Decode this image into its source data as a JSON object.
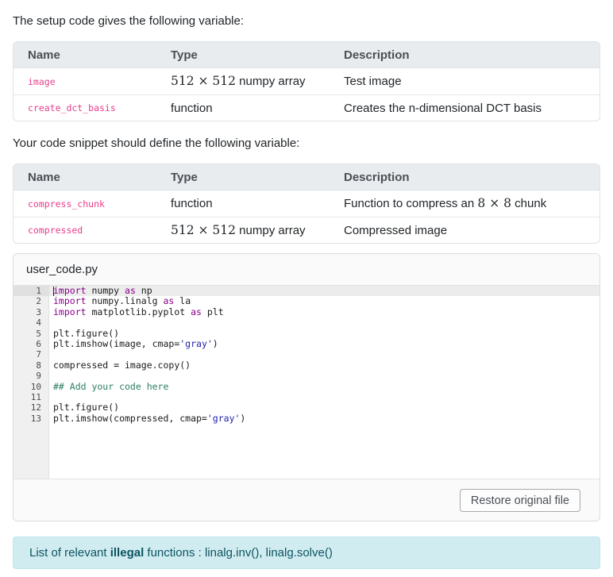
{
  "colors": {
    "accent_code_pink": "#e83e8c",
    "table_header_bg": "#e9ecef",
    "table_border": "#dee2e6",
    "editor_keyword": "#8b008b",
    "editor_string": "#1f1fa8",
    "editor_comment": "#2a7f62",
    "alert_bg": "#d1ecf1",
    "alert_text": "#0c5460"
  },
  "sections": [
    {
      "intro": "The setup code gives the following variable:",
      "columns": [
        "Name",
        "Type",
        "Description"
      ],
      "rows": [
        {
          "name": "image",
          "type": [
            {
              "t": "math",
              "v": "512 × 512"
            },
            {
              "t": "text",
              "v": " numpy array"
            }
          ],
          "description": [
            {
              "t": "text",
              "v": "Test image"
            }
          ]
        },
        {
          "name": "create_dct_basis",
          "type": [
            {
              "t": "text",
              "v": "function"
            }
          ],
          "description": [
            {
              "t": "text",
              "v": "Creates the n-dimensional DCT basis"
            }
          ]
        }
      ]
    },
    {
      "intro": "Your code snippet should define the following variable:",
      "columns": [
        "Name",
        "Type",
        "Description"
      ],
      "rows": [
        {
          "name": "compress_chunk",
          "type": [
            {
              "t": "text",
              "v": "function"
            }
          ],
          "description": [
            {
              "t": "text",
              "v": "Function to compress an "
            },
            {
              "t": "math",
              "v": "8 × 8"
            },
            {
              "t": "text",
              "v": " chunk"
            }
          ]
        },
        {
          "name": "compressed",
          "type": [
            {
              "t": "math",
              "v": "512 × 512"
            },
            {
              "t": "text",
              "v": " numpy array"
            }
          ],
          "description": [
            {
              "t": "text",
              "v": "Compressed image"
            }
          ]
        }
      ]
    }
  ],
  "editor": {
    "filename": "user_code.py",
    "active_line": 1,
    "lines": [
      {
        "num": 1,
        "segments": [
          {
            "t": "kw",
            "v": "import"
          },
          {
            "t": "txt",
            "v": " numpy "
          },
          {
            "t": "kw",
            "v": "as"
          },
          {
            "t": "txt",
            "v": " np"
          }
        ]
      },
      {
        "num": 2,
        "segments": [
          {
            "t": "kw",
            "v": "import"
          },
          {
            "t": "txt",
            "v": " numpy.linalg "
          },
          {
            "t": "kw",
            "v": "as"
          },
          {
            "t": "txt",
            "v": " la"
          }
        ]
      },
      {
        "num": 3,
        "segments": [
          {
            "t": "kw",
            "v": "import"
          },
          {
            "t": "txt",
            "v": " matplotlib.pyplot "
          },
          {
            "t": "kw",
            "v": "as"
          },
          {
            "t": "txt",
            "v": " plt"
          }
        ]
      },
      {
        "num": 4,
        "segments": []
      },
      {
        "num": 5,
        "segments": [
          {
            "t": "txt",
            "v": "plt.figure()"
          }
        ]
      },
      {
        "num": 6,
        "segments": [
          {
            "t": "txt",
            "v": "plt.imshow(image, cmap="
          },
          {
            "t": "str",
            "v": "'gray'"
          },
          {
            "t": "txt",
            "v": ")"
          }
        ]
      },
      {
        "num": 7,
        "segments": []
      },
      {
        "num": 8,
        "segments": [
          {
            "t": "txt",
            "v": "compressed = image.copy()"
          }
        ]
      },
      {
        "num": 9,
        "segments": []
      },
      {
        "num": 10,
        "segments": [
          {
            "t": "com",
            "v": "## Add your code here"
          }
        ]
      },
      {
        "num": 11,
        "segments": []
      },
      {
        "num": 12,
        "segments": [
          {
            "t": "txt",
            "v": "plt.figure()"
          }
        ]
      },
      {
        "num": 13,
        "segments": [
          {
            "t": "txt",
            "v": "plt.imshow(compressed, cmap="
          },
          {
            "t": "str",
            "v": "'gray'"
          },
          {
            "t": "txt",
            "v": ")"
          }
        ]
      }
    ]
  },
  "footer": {
    "restore_button_label": "Restore original file"
  },
  "alert": {
    "prefix": "List of relevant ",
    "bold": "illegal",
    "suffix": " functions : linalg.inv(), linalg.solve()"
  }
}
